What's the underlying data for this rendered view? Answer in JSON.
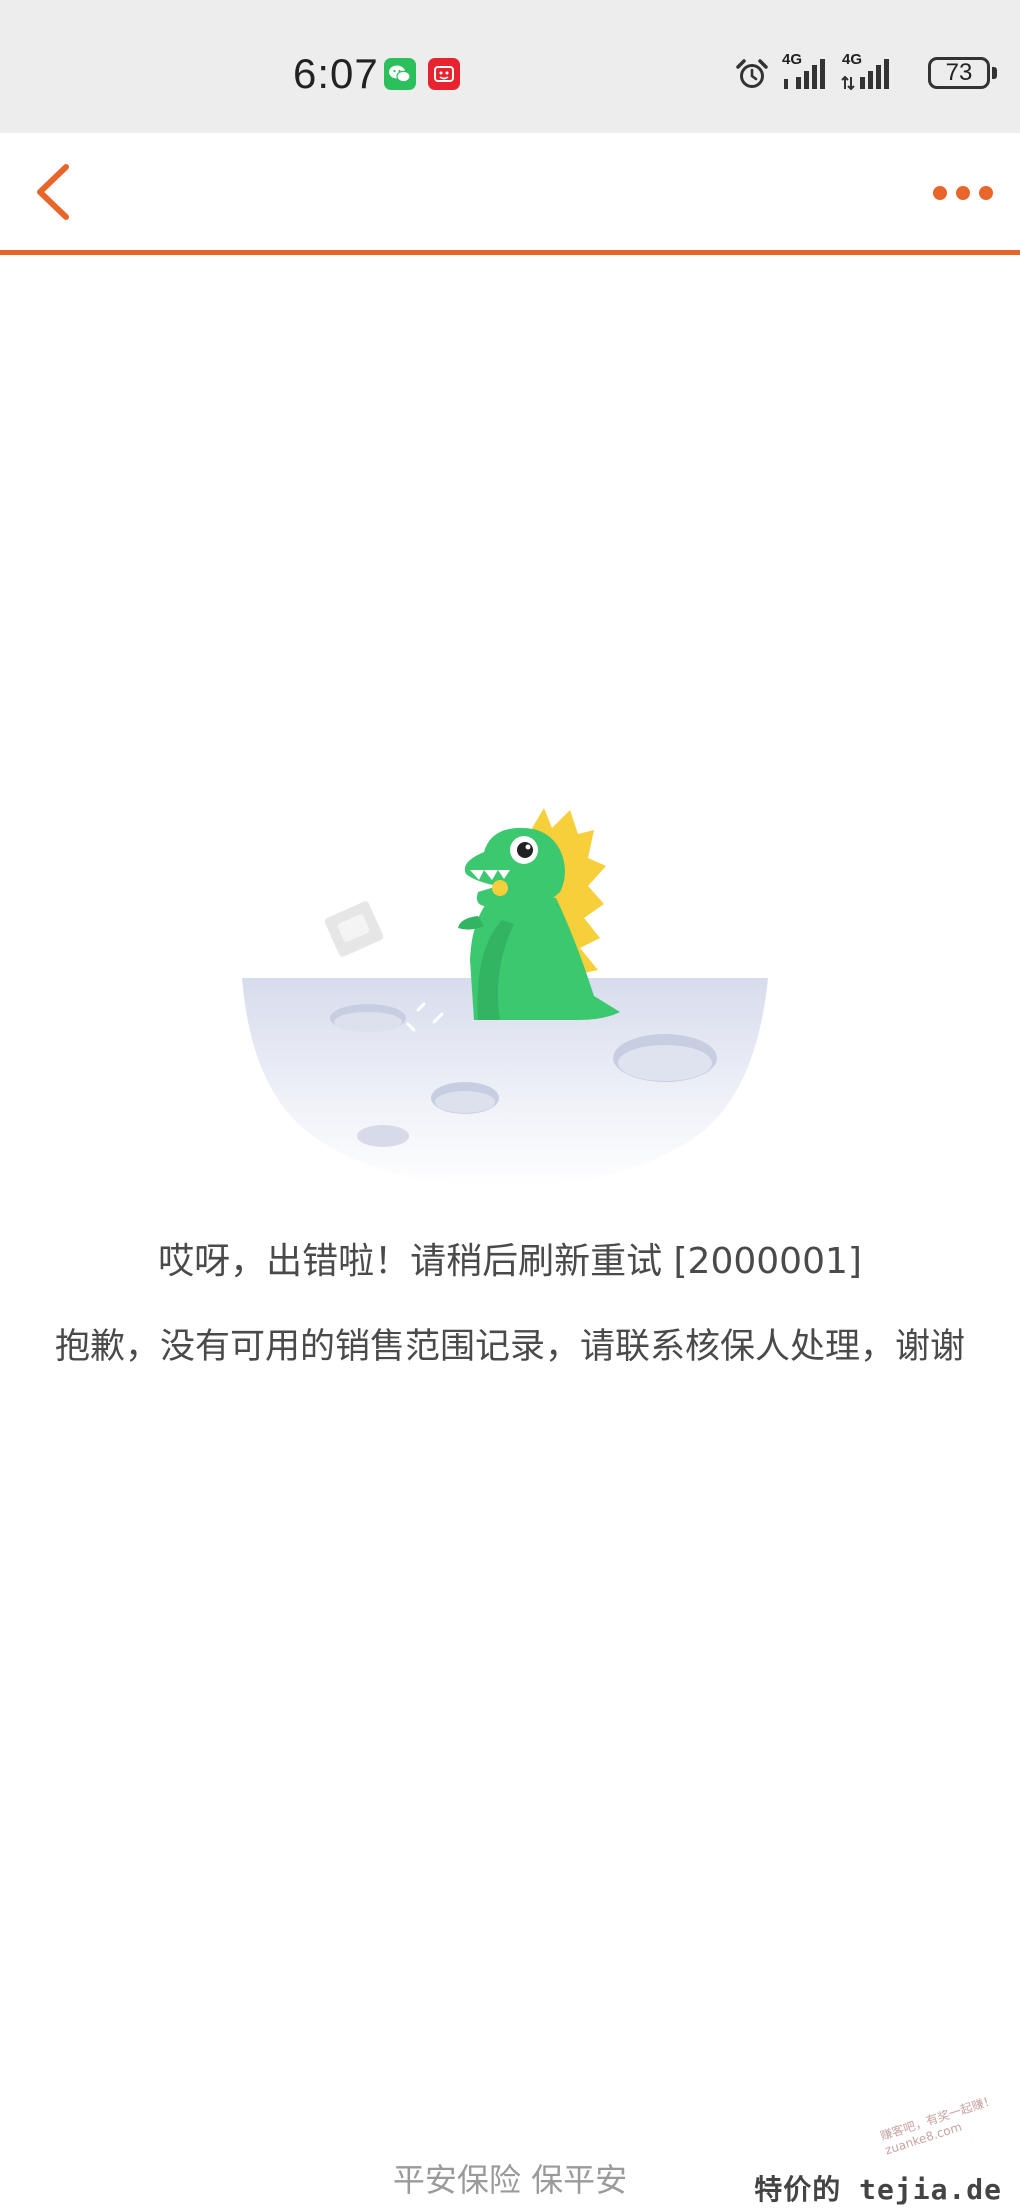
{
  "status_bar": {
    "time": "6:07",
    "network_1": "4G",
    "network_2": "4G",
    "battery": "73",
    "icons": [
      "wechat-icon",
      "red-app-icon",
      "alarm-icon",
      "signal-icon",
      "signal-icon",
      "battery-icon"
    ]
  },
  "nav": {
    "back_icon": "chevron-left-icon",
    "more_icon": "more-dots-icon",
    "accent_color": "#e8662a"
  },
  "error": {
    "title": "哎呀，出错啦！请稍后刷新重试 [2000001]",
    "message": "抱歉，没有可用的销售范围记录，请联系核保人处理，谢谢"
  },
  "footer": {
    "slogan": "平安保险 保平安"
  },
  "watermark": {
    "text": "特价的 tejia.de",
    "small_text": "赚客吧，有奖一起赚！ zuanke8.com"
  }
}
